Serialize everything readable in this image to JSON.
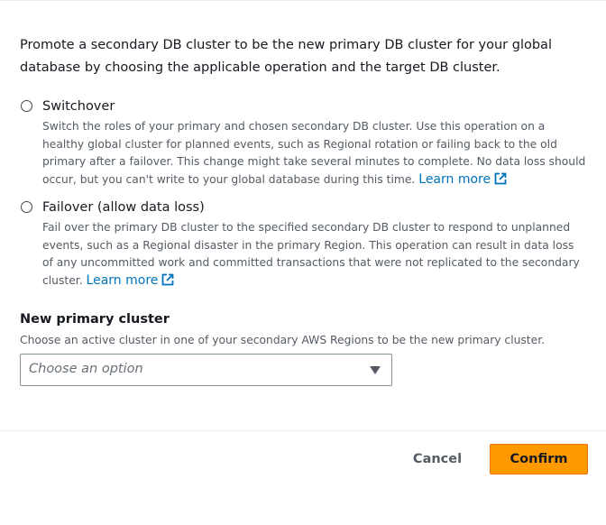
{
  "intro": {
    "text": "Promote a secondary DB cluster to be the new primary DB cluster for your global database by choosing the applicable operation and the target DB cluster."
  },
  "operations": [
    {
      "label": "Switchover",
      "description": "Switch the roles of your primary and chosen secondary DB cluster. Use this operation on a healthy global cluster for planned events, such as Regional rotation or failing back to the old primary after a failover. This change might take several minutes to complete. No data loss should occur, but you can't write to your global database during this time.",
      "learn_more": "Learn more",
      "selected": false
    },
    {
      "label": "Failover (allow data loss)",
      "description": "Fail over the primary DB cluster to the specified secondary DB cluster to respond to unplanned events, such as a Regional disaster in the primary Region. This operation can result in data loss of any uncommitted work and committed transactions that were not replicated to the secondary cluster.",
      "learn_more": "Learn more",
      "selected": false
    }
  ],
  "new_primary": {
    "label": "New primary cluster",
    "description": "Choose an active cluster in one of your secondary AWS Regions to be the new primary cluster.",
    "placeholder": "Choose an option"
  },
  "footer": {
    "cancel_label": "Cancel",
    "confirm_label": "Confirm"
  },
  "icons": {
    "external_link": "external-link-icon",
    "caret": "caret-down-icon"
  },
  "colors": {
    "link": "#0073bb",
    "primary_button": "#ff9900",
    "secondary_text": "#545b64"
  }
}
